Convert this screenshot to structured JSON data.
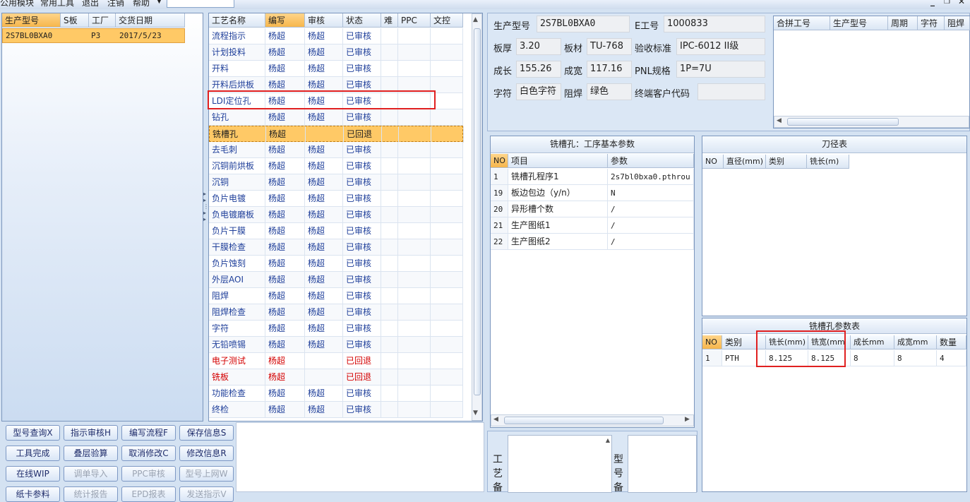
{
  "menu": {
    "items": [
      "公用模块",
      "常用工具",
      "退出",
      "注销",
      "帮助"
    ],
    "win_min": "_",
    "win_restore": "❐",
    "win_close": "✕"
  },
  "left_table": {
    "headers": [
      "生产型号",
      "S板",
      "工厂",
      "交货日期"
    ],
    "row": {
      "model": "2S7BL0BXA0",
      "s": "",
      "factory": "P3",
      "date": "2017/5/23"
    }
  },
  "process_table": {
    "headers": [
      "工艺名称",
      "编写",
      "审核",
      "状态",
      "难",
      "PPC",
      "文控"
    ],
    "rows": [
      {
        "name": "流程指示",
        "writer": "杨超",
        "reviewer": "杨超",
        "status": "已审核",
        "red": false
      },
      {
        "name": "计划投料",
        "writer": "杨超",
        "reviewer": "杨超",
        "status": "已审核",
        "red": false
      },
      {
        "name": "开料",
        "writer": "杨超",
        "reviewer": "杨超",
        "status": "已审核",
        "red": false
      },
      {
        "name": "开料后烘板",
        "writer": "杨超",
        "reviewer": "杨超",
        "status": "已审核",
        "red": false
      },
      {
        "name": "LDI定位孔",
        "writer": "杨超",
        "reviewer": "杨超",
        "status": "已审核",
        "red": false
      },
      {
        "name": "钻孔",
        "writer": "杨超",
        "reviewer": "杨超",
        "status": "已审核",
        "red": false
      },
      {
        "name": "铣槽孔",
        "writer": "杨超",
        "reviewer": "",
        "status": "已回退",
        "red": false
      },
      {
        "name": "去毛刺",
        "writer": "杨超",
        "reviewer": "杨超",
        "status": "已审核",
        "red": false
      },
      {
        "name": "沉铜前烘板",
        "writer": "杨超",
        "reviewer": "杨超",
        "status": "已审核",
        "red": false
      },
      {
        "name": "沉铜",
        "writer": "杨超",
        "reviewer": "杨超",
        "status": "已审核",
        "red": false
      },
      {
        "name": "负片电镀",
        "writer": "杨超",
        "reviewer": "杨超",
        "status": "已审核",
        "red": false
      },
      {
        "name": "负电镀磨板",
        "writer": "杨超",
        "reviewer": "杨超",
        "status": "已审核",
        "red": false
      },
      {
        "name": "负片干膜",
        "writer": "杨超",
        "reviewer": "杨超",
        "status": "已审核",
        "red": false
      },
      {
        "name": "干膜检查",
        "writer": "杨超",
        "reviewer": "杨超",
        "status": "已审核",
        "red": false
      },
      {
        "name": "负片蚀刻",
        "writer": "杨超",
        "reviewer": "杨超",
        "status": "已审核",
        "red": false
      },
      {
        "name": "外层AOI",
        "writer": "杨超",
        "reviewer": "杨超",
        "status": "已审核",
        "red": false
      },
      {
        "name": "阻焊",
        "writer": "杨超",
        "reviewer": "杨超",
        "status": "已审核",
        "red": false
      },
      {
        "name": "阻焊检查",
        "writer": "杨超",
        "reviewer": "杨超",
        "status": "已审核",
        "red": false
      },
      {
        "name": "字符",
        "writer": "杨超",
        "reviewer": "杨超",
        "status": "已审核",
        "red": false
      },
      {
        "name": "无铅喷锡",
        "writer": "杨超",
        "reviewer": "杨超",
        "status": "已审核",
        "red": false
      },
      {
        "name": "电子测试",
        "writer": "杨超",
        "reviewer": "",
        "status": "已回退",
        "red": true
      },
      {
        "name": "铣板",
        "writer": "杨超",
        "reviewer": "",
        "status": "已回退",
        "red": true
      },
      {
        "name": "功能检查",
        "writer": "杨超",
        "reviewer": "杨超",
        "status": "已审核",
        "red": false
      },
      {
        "name": "终检",
        "writer": "杨超",
        "reviewer": "杨超",
        "status": "已审核",
        "red": false
      }
    ]
  },
  "info": {
    "model_label": "生产型号",
    "model": "2S7BL0BXA0",
    "e_label": "E工号",
    "e": "1000833",
    "thickness_label": "板厚",
    "thickness": "3.20",
    "material_label": "板材",
    "material": "TU-768",
    "standard_label": "验收标准",
    "standard": "IPC-6012 II级",
    "length_label": "成长",
    "length": "155.26",
    "width_label": "成宽",
    "width": "117.16",
    "pnl_label": "PNL规格",
    "pnl": "1P=7U",
    "char_label": "字符",
    "char": "白色字符",
    "mask_label": "阻焊",
    "mask": "绿色",
    "customer_label": "终端客户代码",
    "customer": ""
  },
  "merge_table": {
    "headers": [
      "合拼工号",
      "生产型号",
      "周期",
      "字符",
      "阻焊"
    ]
  },
  "params": {
    "title": "铣槽孔：工序基本参数",
    "headers": [
      "NO",
      "项目",
      "参数"
    ],
    "rows": [
      {
        "no": "1",
        "item": "铣槽孔程序1",
        "value": "2s7bl0bxa0.pthrou"
      },
      {
        "no": "19",
        "item": "板边包边（y/n）",
        "value": "N"
      },
      {
        "no": "20",
        "item": "异形槽个数",
        "value": "/"
      },
      {
        "no": "21",
        "item": "生产图纸1",
        "value": "/"
      },
      {
        "no": "22",
        "item": "生产图纸2",
        "value": "/"
      }
    ]
  },
  "tool_table": {
    "title": "刀径表",
    "headers": [
      "NO",
      "直径(mm)",
      "类别",
      "铣长(m)"
    ]
  },
  "slot_params": {
    "title": "铣槽孔参数表",
    "headers": [
      "NO",
      "类别",
      "铣长(mm)",
      "铣宽(mm",
      "成长mm",
      "成宽mm",
      "数量"
    ],
    "row": {
      "no": "1",
      "type": "PTH",
      "len": "8.125",
      "wid": "8.125",
      "grow": "8",
      "gwid": "8",
      "qty": "4"
    }
  },
  "remarks": {
    "process_label": "工艺备",
    "model_label": "型号备"
  },
  "buttons": [
    {
      "label": "型号查询X",
      "disabled": false
    },
    {
      "label": "指示审核H",
      "disabled": false
    },
    {
      "label": "编写流程F",
      "disabled": false
    },
    {
      "label": "保存信息S",
      "disabled": false
    },
    {
      "label": "工具完成",
      "disabled": false
    },
    {
      "label": "叠层验算",
      "disabled": false
    },
    {
      "label": "取消修改C",
      "disabled": false
    },
    {
      "label": "修改信息R",
      "disabled": false
    },
    {
      "label": "在线WIP",
      "disabled": false
    },
    {
      "label": "调单导入",
      "disabled": true
    },
    {
      "label": "PPC审核",
      "disabled": true
    },
    {
      "label": "型号上网W",
      "disabled": true
    },
    {
      "label": "纸卡参料",
      "disabled": false
    },
    {
      "label": "统计报告",
      "disabled": true
    },
    {
      "label": "EPD报表",
      "disabled": true
    },
    {
      "label": "发送指示V",
      "disabled": true
    }
  ],
  "colors": {
    "highlight": "#ffc966",
    "panel_bg": "#d4e2f2",
    "red_box": "#e02020"
  }
}
